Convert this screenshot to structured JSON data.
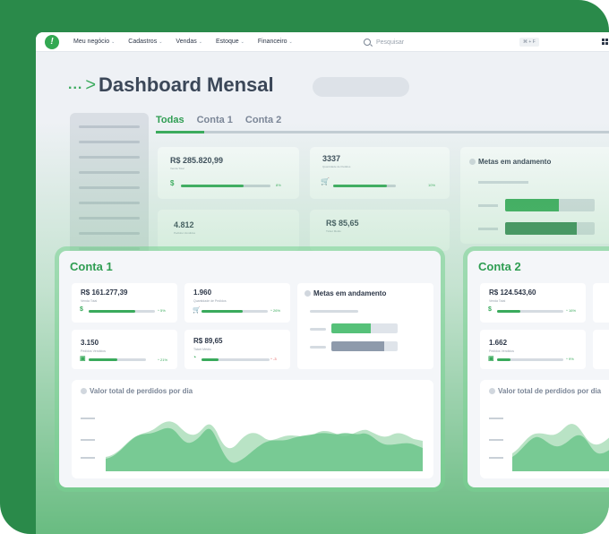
{
  "nav": {
    "logo": "!",
    "menu": [
      "Meu negócio",
      "Cadastros",
      "Vendas",
      "Estoque",
      "Financeiro"
    ],
    "search_placeholder": "Pesquisar",
    "shortcut": "⌘ + F"
  },
  "page": {
    "dots": "...",
    "arrow": ">",
    "title": "Dashboard Mensal"
  },
  "tabs": [
    "Todas",
    "Conta 1",
    "Conta 2"
  ],
  "background_cards": {
    "total": {
      "value": "R$ 285.820,99",
      "sub": "Venda Total",
      "icon": "$",
      "progress": 0.7,
      "pct": "8%"
    },
    "orders": {
      "value": "3337",
      "sub": "Quantidade de Pedidos",
      "icon": "🛒",
      "progress": 0.85,
      "pct": "10%"
    },
    "delivered": {
      "value": "4.812",
      "sub": "Pedidos Vendidos"
    },
    "ticket": {
      "value": "R$ 85,65",
      "sub": "Ticket Médio"
    },
    "metas_title": "Metas em andamento",
    "metas_progress": [
      0.6,
      0.8
    ]
  },
  "conta1": {
    "title": "Conta 1",
    "kpis": [
      {
        "value": "R$ 161.277,39",
        "label": "Venda Total",
        "icon": "$",
        "progress": 0.7,
        "pct": "^ 5%",
        "neg": false
      },
      {
        "value": "1.960",
        "label": "Quantidade de Pedidos",
        "icon": "🛒",
        "progress": 0.62,
        "pct": "^ 26%",
        "neg": false
      },
      {
        "value": "3.150",
        "label": "Pedidos Vendidos",
        "icon": "▣",
        "progress": 0.5,
        "pct": "^ 21%",
        "neg": false
      },
      {
        "value": "R$ 89,65",
        "label": "Ticket Médio",
        "icon": "◔",
        "progress": 0.25,
        "pct": "^ -3",
        "neg": true
      }
    ],
    "metas_title": "Metas em andamento",
    "metas_progress": [
      0.6,
      0.8
    ],
    "chart_title": "Valor total de perdidos por dia"
  },
  "conta2": {
    "title": "Conta 2",
    "kpis": [
      {
        "value": "R$ 124.543,60",
        "label": "Venda Total",
        "icon": "$",
        "progress": 0.35,
        "pct": "^ 16%",
        "neg": false
      },
      {
        "value": "1.662",
        "label": "Pedidos Vendidos",
        "icon": "▣",
        "progress": 0.2,
        "pct": "^ 9%",
        "neg": false
      }
    ],
    "chart_title": "Valor total de perdidos por dia"
  },
  "colors": {
    "brand": "#2a8a4a",
    "accent": "#3aaa5c",
    "metas_bar2": "#8e9aab"
  }
}
